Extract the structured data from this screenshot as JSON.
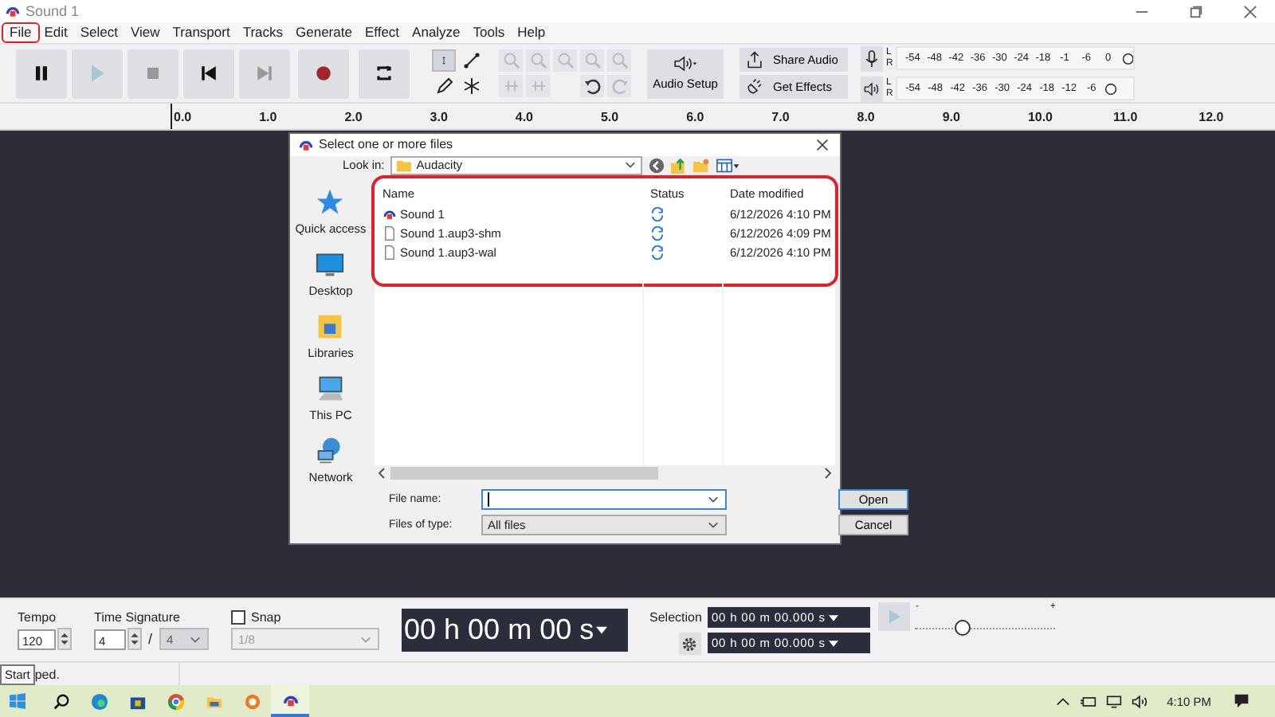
{
  "window": {
    "title": "Sound 1"
  },
  "menu": [
    {
      "label": "File",
      "annotated": true
    },
    {
      "label": "Edit",
      "annotated": false
    },
    {
      "label": "Select",
      "annotated": false
    },
    {
      "label": "View",
      "annotated": false
    },
    {
      "label": "Transport",
      "annotated": false
    },
    {
      "label": "Tracks",
      "annotated": false
    },
    {
      "label": "Generate",
      "annotated": false
    },
    {
      "label": "Effect",
      "annotated": false
    },
    {
      "label": "Analyze",
      "annotated": false
    },
    {
      "label": "Tools",
      "annotated": false
    },
    {
      "label": "Help",
      "annotated": false
    }
  ],
  "transport": [
    {
      "kind": "pause",
      "disabled": false
    },
    {
      "kind": "play",
      "disabled": true
    },
    {
      "kind": "stop",
      "disabled": true
    },
    {
      "kind": "skip_start",
      "disabled": false
    },
    {
      "kind": "skip_end",
      "disabled": true
    },
    {
      "kind": "record",
      "disabled": false
    },
    {
      "kind": "loop",
      "disabled": false
    }
  ],
  "tools": [
    {
      "kind": "select",
      "selected": true
    },
    {
      "kind": "envelope",
      "selected": false
    },
    {
      "kind": "draw",
      "selected": false
    },
    {
      "kind": "multi",
      "selected": false
    }
  ],
  "edit_tools": [
    {
      "kind": "zoom_in",
      "disabled": true
    },
    {
      "kind": "zoom_out",
      "disabled": true
    },
    {
      "kind": "fit_selection",
      "disabled": true
    },
    {
      "kind": "fit_project",
      "disabled": true
    },
    {
      "kind": "zoom_toggle",
      "disabled": true
    },
    {
      "kind": "trim",
      "disabled": true
    },
    {
      "kind": "silence",
      "disabled": true
    },
    {
      "kind": "undo",
      "disabled": false
    },
    {
      "kind": "redo",
      "disabled": true
    }
  ],
  "audio_setup": {
    "label": "Audio Setup"
  },
  "share": [
    {
      "kind": "share",
      "label": "Share Audio"
    },
    {
      "kind": "effects",
      "label": "Get Effects"
    }
  ],
  "meters": [
    {
      "kind": "record",
      "channels": [
        "L",
        "R"
      ],
      "scale": [
        "-54",
        "-48",
        "-42",
        "-36",
        "-30",
        "-24",
        "-18",
        "-1",
        "-6",
        "0"
      ]
    },
    {
      "kind": "playback",
      "channels": [
        "L",
        "R"
      ],
      "scale": [
        "-54",
        "-48",
        "-42",
        "-36",
        "-30",
        "-24",
        "-18",
        "-12",
        "-6"
      ]
    }
  ],
  "ruler": {
    "ticks": [
      "0.0",
      "1.0",
      "2.0",
      "3.0",
      "4.0",
      "5.0",
      "6.0",
      "7.0",
      "8.0",
      "9.0",
      "10.0",
      "11.0",
      "12.0"
    ]
  },
  "dialog": {
    "title": "Select one or more files",
    "look_in": {
      "label": "Look in:",
      "value": "Audacity"
    },
    "places": [
      {
        "kind": "quick_access",
        "label": "Quick access"
      },
      {
        "kind": "desktop",
        "label": "Desktop"
      },
      {
        "kind": "libraries",
        "label": "Libraries"
      },
      {
        "kind": "this_pc",
        "label": "This PC"
      },
      {
        "kind": "network",
        "label": "Network"
      }
    ],
    "file_list": {
      "annotated": true,
      "columns": [
        "Name",
        "Status",
        "Date modified"
      ],
      "rows": [
        {
          "kind": "project",
          "name": "Sound 1",
          "date": "6/12/2026 4:10 PM"
        },
        {
          "kind": "file",
          "name": "Sound 1.aup3-shm",
          "date": "6/12/2026 4:09 PM"
        },
        {
          "kind": "file",
          "name": "Sound 1.aup3-wal",
          "date": "6/12/2026 4:10 PM"
        }
      ]
    },
    "file_name": {
      "label": "File name:"
    },
    "file_type": {
      "label": "Files of type:",
      "value": "All files"
    },
    "buttons": [
      "Open",
      "Cancel"
    ]
  },
  "bottom": {
    "tempo": {
      "label": "Tempo",
      "value": "120"
    },
    "time_signature": {
      "label": "Time Signature",
      "upper": "4",
      "separator": "/",
      "lower": "4"
    },
    "snap": {
      "label": "Snap",
      "checked": false,
      "value": "1/8"
    },
    "time": "00 h 00 m 00 s",
    "selection": {
      "label": "Selection",
      "start": "00 h 00 m 00.000 s",
      "end": "00 h 00 m 00.000 s"
    },
    "speed": {
      "min_label": "-",
      "max_label": "+",
      "level": 0.34
    }
  },
  "status": {
    "tooltip": "Start",
    "text": "ped."
  },
  "taskbar": {
    "apps": [
      {
        "kind": "search",
        "active": false
      },
      {
        "kind": "edge",
        "active": false
      },
      {
        "kind": "store",
        "active": false
      },
      {
        "kind": "chrome",
        "active": false
      },
      {
        "kind": "explorer",
        "active": false
      },
      {
        "kind": "app",
        "active": false
      },
      {
        "kind": "audacity",
        "active": true
      }
    ],
    "clock": "4:10 PM"
  }
}
